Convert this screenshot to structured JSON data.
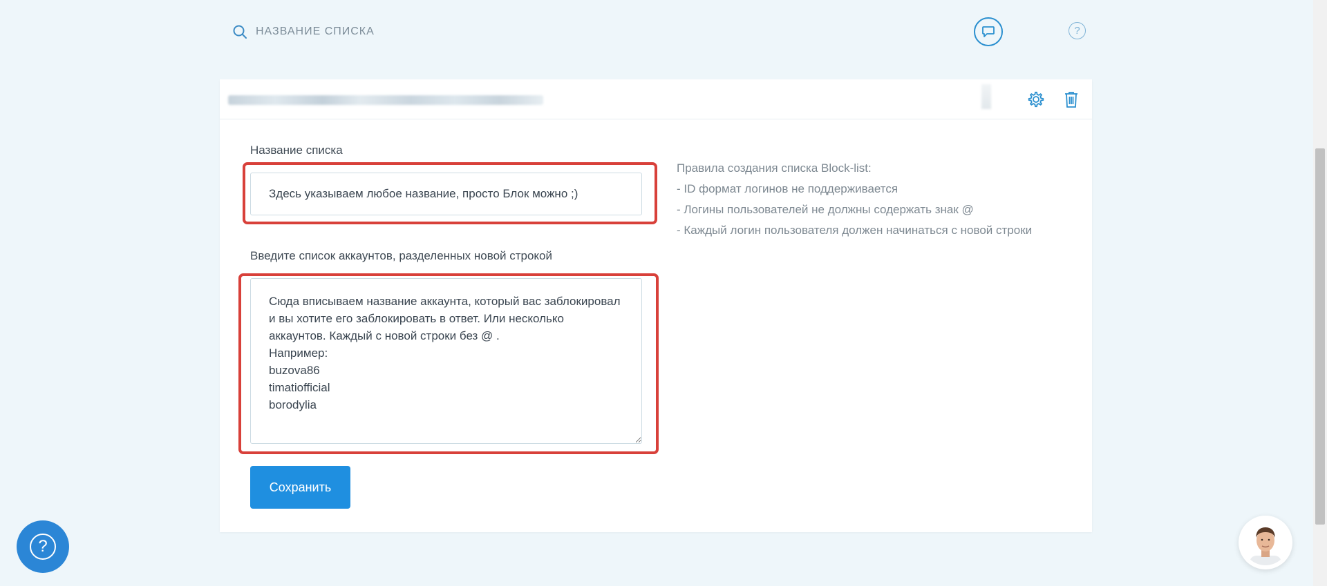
{
  "search": {
    "placeholder": "НАЗВАНИЕ СПИСКА"
  },
  "header": {
    "chat_icon": "chat-bubble-icon",
    "help_icon": "question-icon"
  },
  "card": {
    "name_label": "Название списка",
    "name_value": "Здесь указываем любое название, просто Блок можно ;)",
    "accounts_label": "Введите список аккаунтов, разделенных новой строкой",
    "accounts_value": "Сюда вписываем название аккаунта, который вас заблокировал\nи вы хотите его заблокировать в ответ. Или несколько\nаккаунтов. Каждый с новой строки без @ .\nНапример:\nbuzova86\ntimatiofficial\nborodylia",
    "save_label": "Сохранить"
  },
  "rules": {
    "title": "Правила создания списка Block-list:",
    "items": [
      "- ID формат логинов не поддерживается",
      "- Логины пользователей не должны содержать знак @",
      "- Каждый логин пользователя должен начинаться с новой строки"
    ]
  },
  "colors": {
    "accent": "#1f8fe0",
    "highlight": "#d8403a",
    "background": "#eef6fa"
  }
}
